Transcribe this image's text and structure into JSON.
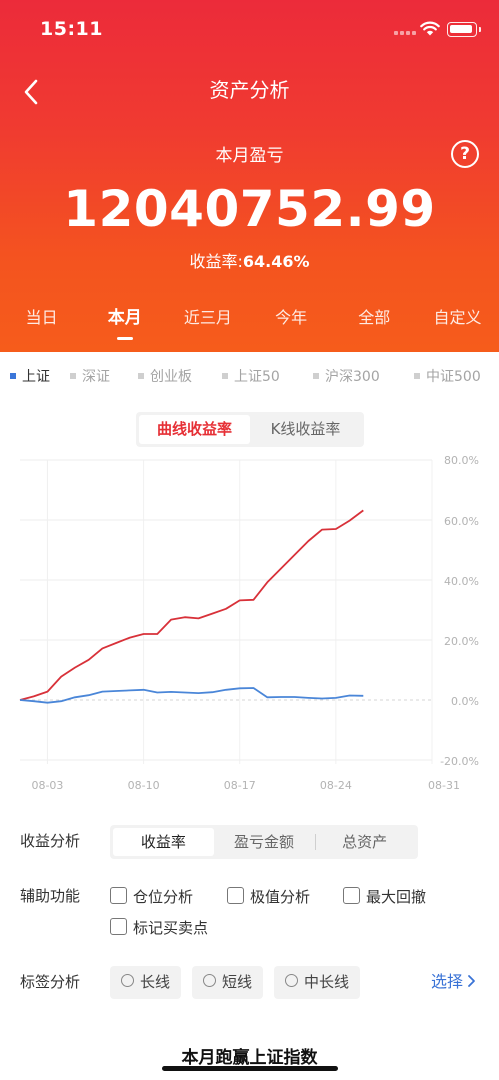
{
  "status_bar": {
    "time": "15:11"
  },
  "nav": {
    "title": "资产分析"
  },
  "summary": {
    "label": "本月盈亏",
    "help": "?",
    "value": "12040752.99",
    "rate_label": "收益率:",
    "rate_value": "64.46%"
  },
  "period_tabs": [
    {
      "label": "当日",
      "active": false
    },
    {
      "label": "本月",
      "active": true
    },
    {
      "label": "近三月",
      "active": false
    },
    {
      "label": "今年",
      "active": false
    },
    {
      "label": "全部",
      "active": false
    },
    {
      "label": "自定义",
      "active": false
    }
  ],
  "indices": [
    {
      "label": "上证",
      "active": true
    },
    {
      "label": "深证",
      "active": false
    },
    {
      "label": "创业板",
      "active": false
    },
    {
      "label": "上证50",
      "active": false
    },
    {
      "label": "沪深300",
      "active": false
    },
    {
      "label": "中证500",
      "active": false
    }
  ],
  "chart_switch": {
    "curve": "曲线收益率",
    "kline": "K线收益率"
  },
  "colors": {
    "accent": "#e63036",
    "portfolio_line": "#d83139",
    "index_line": "#4a86d8",
    "link": "#3a73d6"
  },
  "chart_data": {
    "type": "line",
    "x": [
      "08-01",
      "08-02",
      "08-03",
      "08-04",
      "08-05",
      "08-06",
      "08-07",
      "08-08",
      "08-09",
      "08-10",
      "08-11",
      "08-12",
      "08-13",
      "08-14",
      "08-15",
      "08-16",
      "08-17",
      "08-18",
      "08-19",
      "08-20",
      "08-21",
      "08-22",
      "08-23",
      "08-24",
      "08-25",
      "08-26"
    ],
    "xticks": [
      "08-03",
      "08-10",
      "08-17",
      "08-24",
      "08-31"
    ],
    "x_domain": [
      "08-01",
      "08-31"
    ],
    "yticks": [
      "80.0%",
      "60.0%",
      "40.0%",
      "20.0%",
      "0.0%",
      "-20.0%"
    ],
    "ylim": [
      -20,
      80
    ],
    "grid": true,
    "series": [
      {
        "values": [
          0,
          1.2,
          2.8,
          7.8,
          10.8,
          13.4,
          17.2,
          19,
          20.8,
          22,
          22,
          26.8,
          27.6,
          27.2,
          28.8,
          30.4,
          33.2,
          33.4,
          39.2,
          43.8,
          48.4,
          53,
          56.8,
          57,
          59.8,
          63.2
        ]
      },
      {
        "values": [
          0,
          -0.4,
          -0.9,
          -0.4,
          0.9,
          1.6,
          2.8,
          3,
          3.2,
          3.4,
          2.5,
          2.7,
          2.5,
          2.3,
          2.6,
          3.4,
          3.9,
          4,
          0.9,
          1,
          1,
          0.7,
          0.5,
          0.7,
          1.5,
          1.4
        ]
      }
    ]
  },
  "analysis": {
    "label": "收益分析",
    "options": [
      {
        "label": "收益率",
        "active": true
      },
      {
        "label": "盈亏金额",
        "active": false
      },
      {
        "label": "总资产",
        "active": false
      }
    ]
  },
  "aux": {
    "label": "辅助功能",
    "options": [
      "仓位分析",
      "极值分析",
      "最大回撤",
      "标记买卖点"
    ]
  },
  "tags": {
    "label": "标签分析",
    "options": [
      "长线",
      "短线",
      "中长线"
    ],
    "select": "选择"
  },
  "footer": {
    "title": "本月跑赢上证指数"
  }
}
